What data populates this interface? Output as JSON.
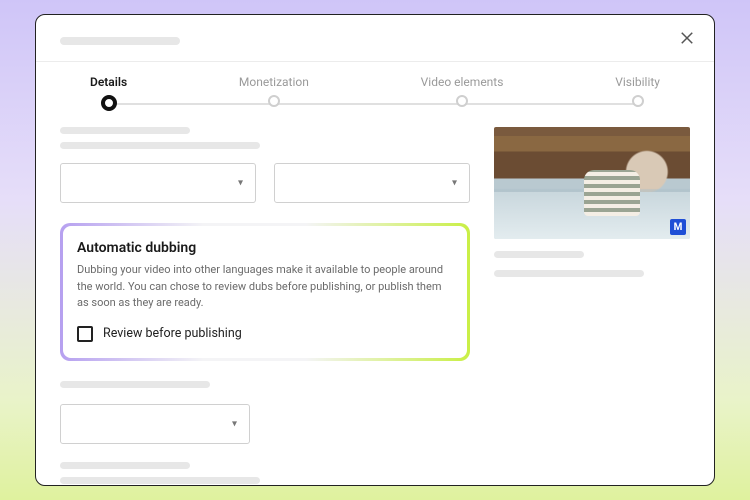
{
  "stepper": {
    "steps": [
      {
        "label": "Details",
        "active": true
      },
      {
        "label": "Monetization",
        "active": false
      },
      {
        "label": "Video elements",
        "active": false
      },
      {
        "label": "Visibility",
        "active": false
      }
    ]
  },
  "feature": {
    "title": "Automatic dubbing",
    "description": "Dubbing your video into other languages make it available to people around the world. You can chose to review dubs before publishing, or publish them as soon as they are ready.",
    "checkbox_label": "Review before publishing",
    "checked": false
  },
  "thumbnail": {
    "badge": "M"
  }
}
